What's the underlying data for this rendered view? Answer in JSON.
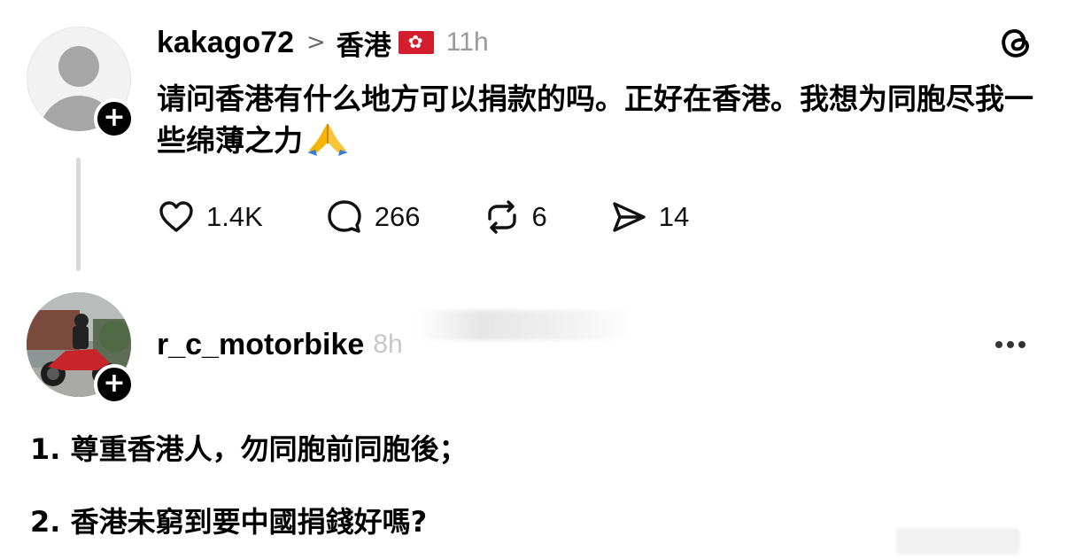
{
  "post": {
    "username": "kakago72",
    "region": "香港",
    "region_flag_icon": "hong-kong-flag-icon",
    "time": "11h",
    "text": "请问香港有什么地方可以捐款的吗。正好在香港。我想为同胞尽我一些绵薄之力",
    "emoji_icon": "folded-hands-icon",
    "likes": "1.4K",
    "replies": "266",
    "reposts": "6",
    "shares": "14"
  },
  "reply": {
    "username": "r_c_motorbike",
    "time": "8h",
    "lines": [
      "1. 尊重香港人，勿同胞前同胞後；",
      "2. 香港未窮到要中國捐錢好嗎?"
    ]
  },
  "colors": {
    "text": "#000000",
    "muted": "#9a9a9a",
    "hk_flag_red": "#d31f2d",
    "thread_line": "#d9d9d9"
  }
}
